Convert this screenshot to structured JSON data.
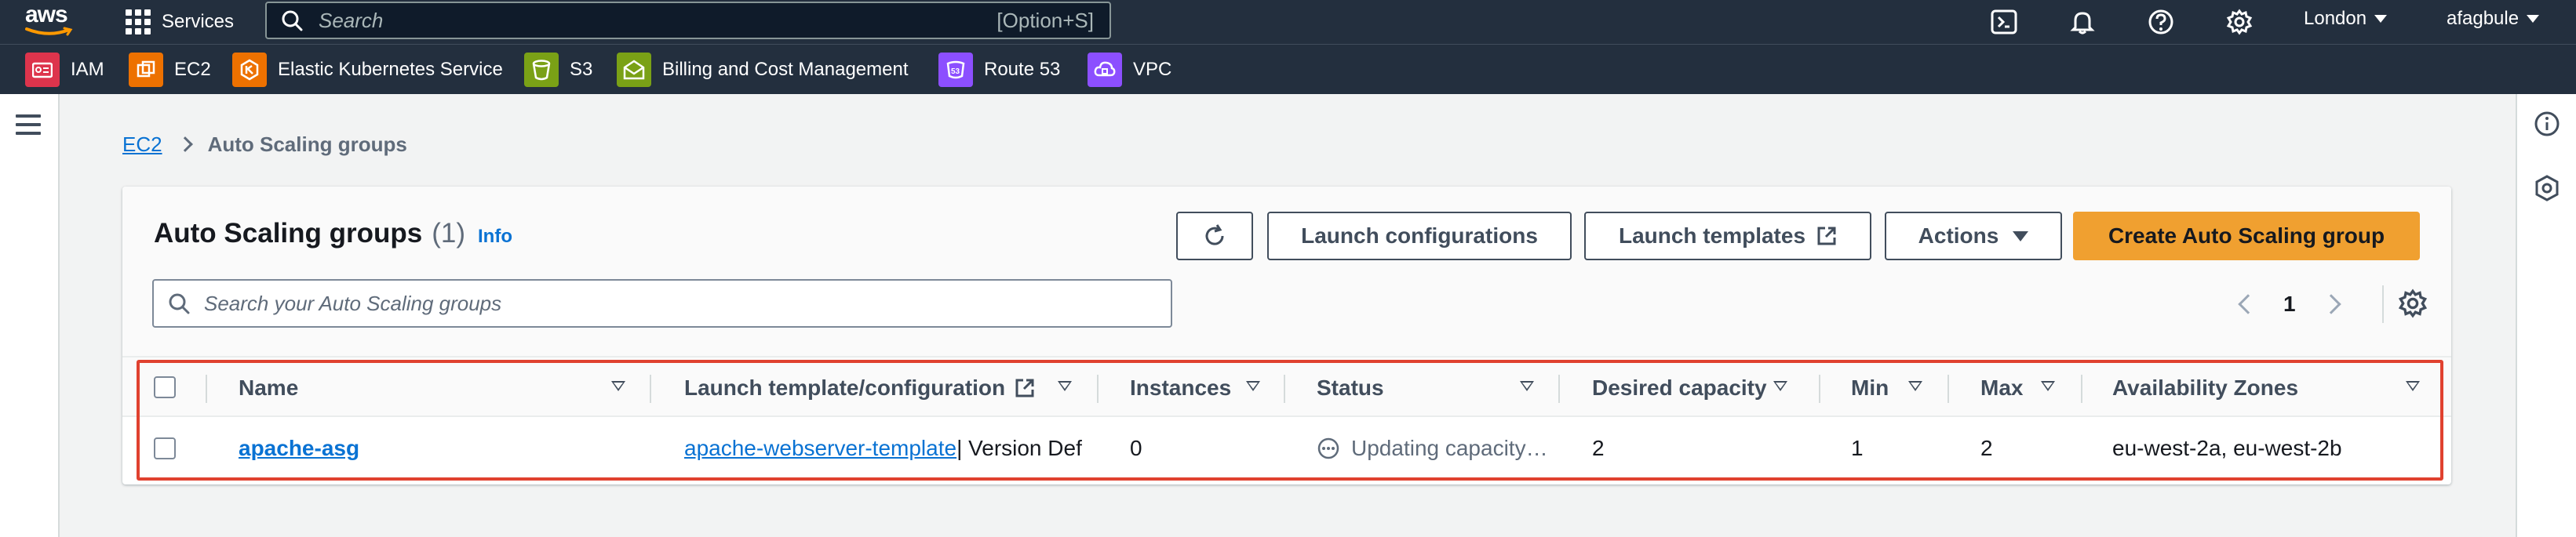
{
  "nav": {
    "logo_text": "aws",
    "services_label": "Services",
    "search_placeholder": "Search",
    "search_shortcut": "[Option+S]",
    "region": "London",
    "user": "afagbule"
  },
  "favorites": [
    {
      "label": "IAM",
      "icon": "iam-icon",
      "color": "#dd344c"
    },
    {
      "label": "EC2",
      "icon": "ec2-icon",
      "color": "#ed7100"
    },
    {
      "label": "Elastic Kubernetes Service",
      "icon": "eks-icon",
      "color": "#ed7100"
    },
    {
      "label": "S3",
      "icon": "s3-icon",
      "color": "#7aa116"
    },
    {
      "label": "Billing and Cost Management",
      "icon": "billing-icon",
      "color": "#7aa116"
    },
    {
      "label": "Route 53",
      "icon": "route53-icon",
      "color": "#8c4fff"
    },
    {
      "label": "VPC",
      "icon": "vpc-icon",
      "color": "#8c4fff"
    }
  ],
  "breadcrumb": {
    "parent": "EC2",
    "current": "Auto Scaling groups"
  },
  "panel": {
    "title": "Auto Scaling groups",
    "count": "(1)",
    "info": "Info",
    "buttons": {
      "launch_configurations": "Launch configurations",
      "launch_templates": "Launch templates",
      "actions": "Actions",
      "create": "Create Auto Scaling group"
    },
    "search_placeholder": "Search your Auto Scaling groups",
    "page": "1"
  },
  "table": {
    "columns": [
      "Name",
      "Launch template/configuration",
      "Instances",
      "Status",
      "Desired capacity",
      "Min",
      "Max",
      "Availability Zones"
    ],
    "rows": [
      {
        "name": "apache-asg",
        "template_link": "apache-webserver-template",
        "template_suffix": " | Version Def",
        "instances": "0",
        "status": "Updating capacity…",
        "desired": "2",
        "min": "1",
        "max": "2",
        "zones": "eu-west-2a, eu-west-2b"
      }
    ]
  },
  "colors": {
    "nav_bg": "#232f3e",
    "link": "#0972d3",
    "primary_button": "#f0a030",
    "highlight": "#e0412f"
  }
}
